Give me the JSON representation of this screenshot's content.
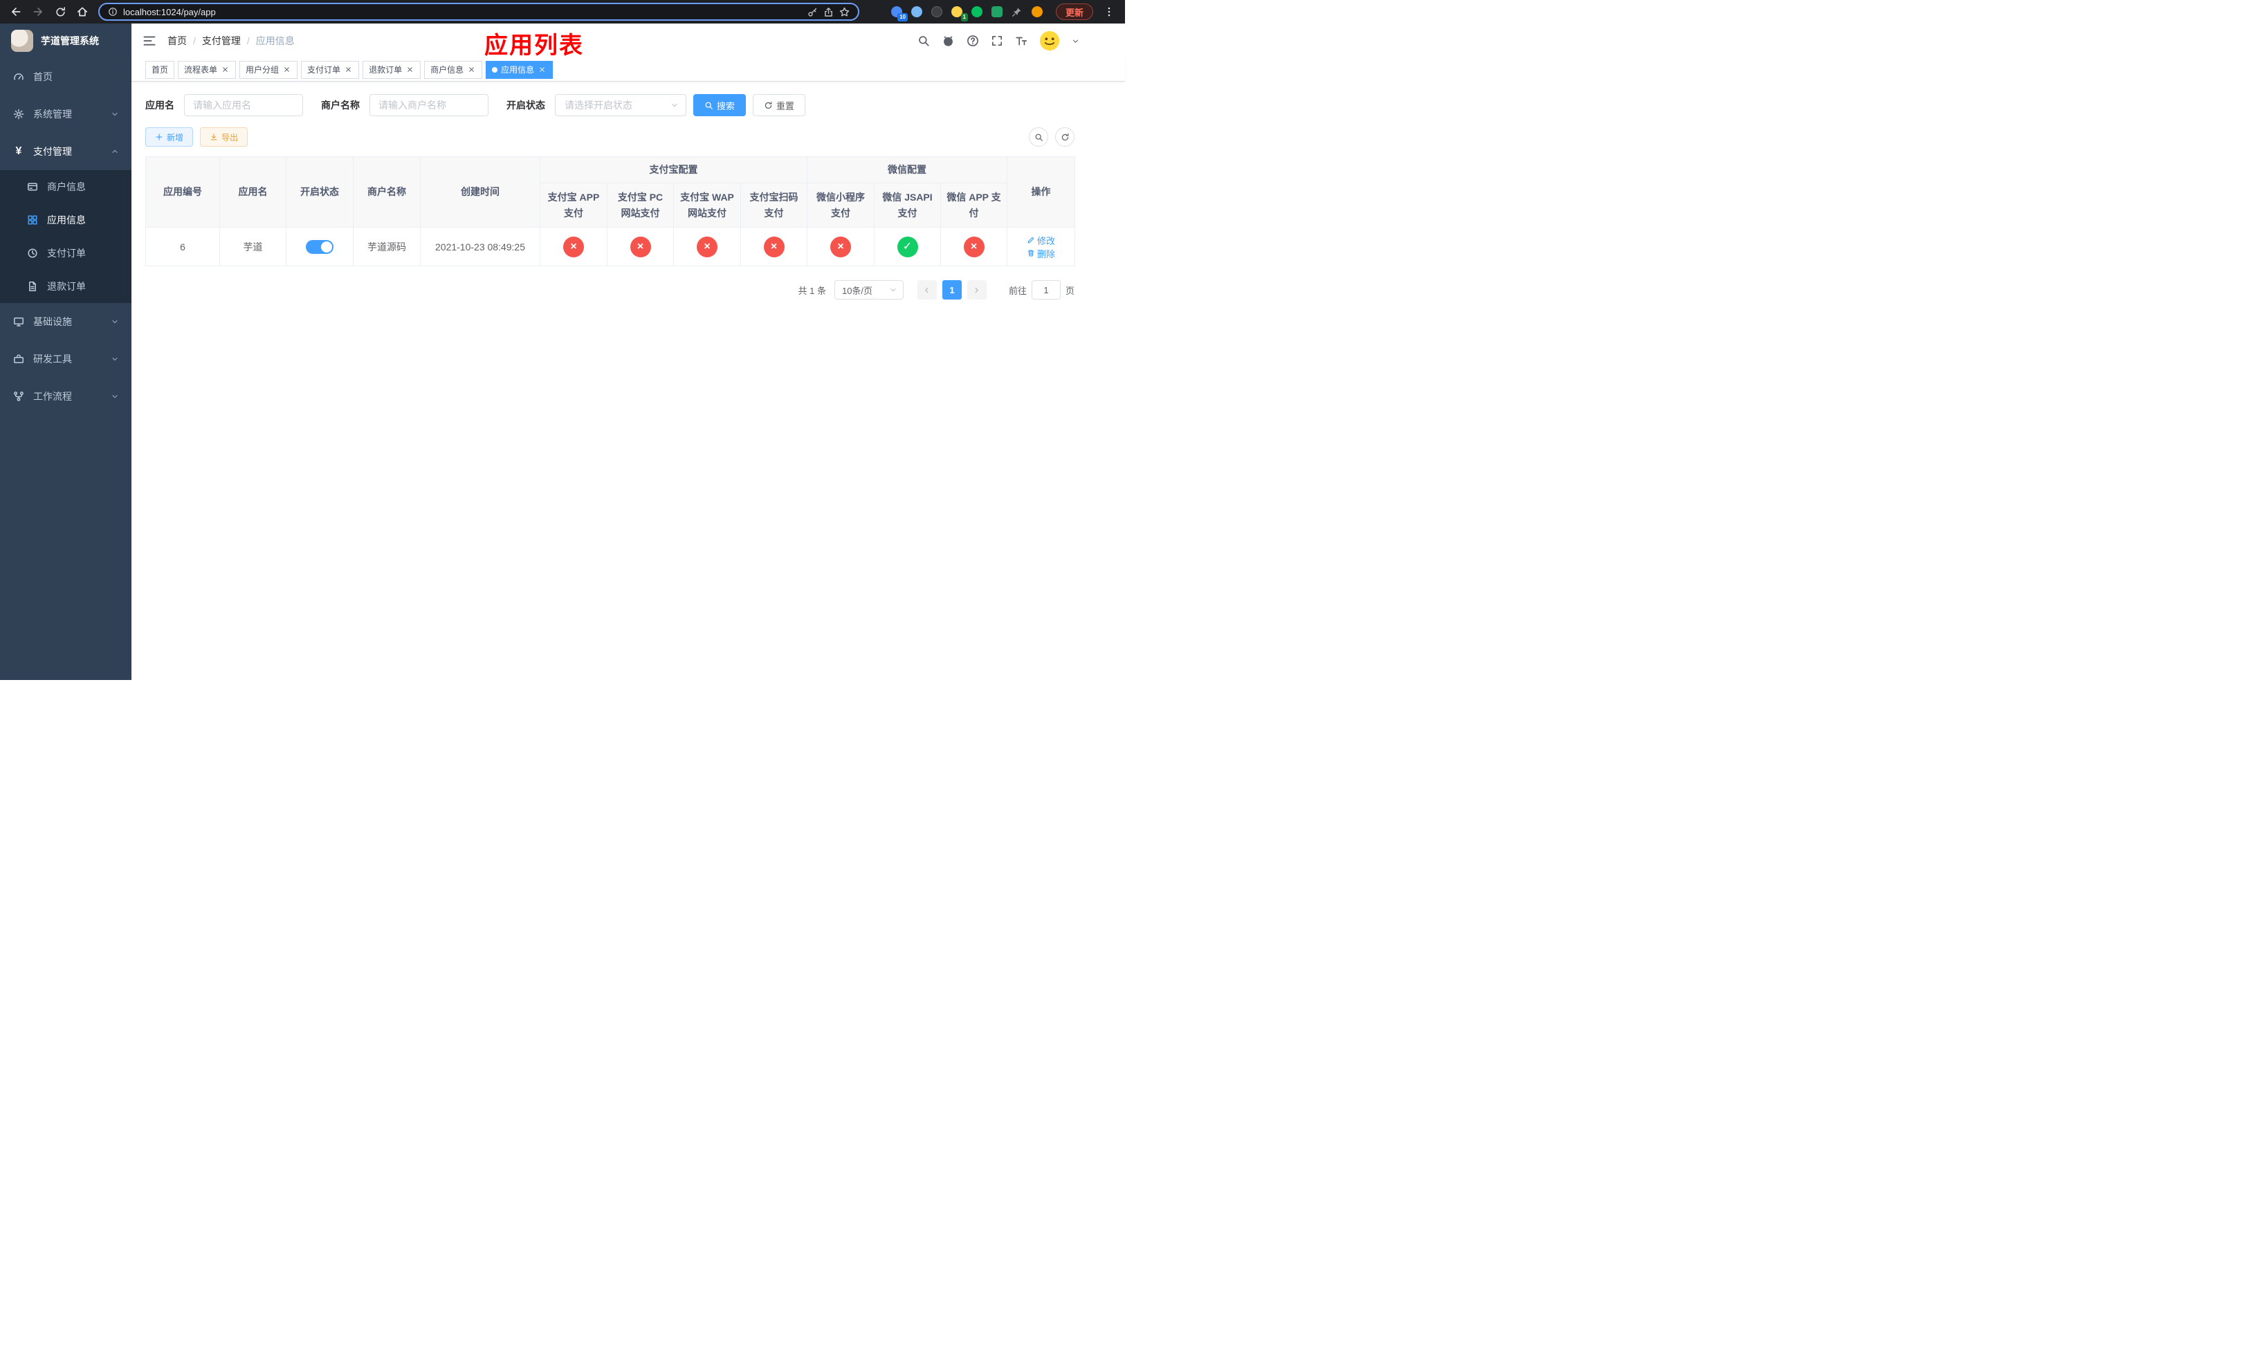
{
  "browser": {
    "url": "localhost:1024/pay/app",
    "update_label": "更新",
    "extensions": {
      "badge_blue": "10",
      "badge_green": "1"
    }
  },
  "sidebar": {
    "logo_title": "芋道管理系统",
    "menu": [
      {
        "label": "首页"
      },
      {
        "label": "系统管理"
      },
      {
        "label": "支付管理",
        "icon_glyph": "¥",
        "children": [
          {
            "label": "商户信息"
          },
          {
            "label": "应用信息"
          },
          {
            "label": "支付订单"
          },
          {
            "label": "退款订单"
          }
        ]
      },
      {
        "label": "基础设施"
      },
      {
        "label": "研发工具"
      },
      {
        "label": "工作流程"
      }
    ]
  },
  "navbar": {
    "breadcrumb": [
      "首页",
      "支付管理",
      "应用信息"
    ],
    "separator": "/",
    "page_title": "应用列表"
  },
  "tabs": [
    {
      "label": "首页",
      "closable": false,
      "active": false
    },
    {
      "label": "流程表单",
      "closable": true,
      "active": false
    },
    {
      "label": "用户分组",
      "closable": true,
      "active": false
    },
    {
      "label": "支付订单",
      "closable": true,
      "active": false
    },
    {
      "label": "退款订单",
      "closable": true,
      "active": false
    },
    {
      "label": "商户信息",
      "closable": true,
      "active": false
    },
    {
      "label": "应用信息",
      "closable": true,
      "active": true
    }
  ],
  "filters": {
    "app_name_label": "应用名",
    "app_name_placeholder": "请输入应用名",
    "merchant_label": "商户名称",
    "merchant_placeholder": "请输入商户名称",
    "status_label": "开启状态",
    "status_placeholder": "请选择开启状态",
    "search_label": "搜索",
    "reset_label": "重置"
  },
  "toolbar": {
    "add_label": "新增",
    "export_label": "导出"
  },
  "table": {
    "headers": {
      "app_id": "应用编号",
      "app_name": "应用名",
      "status": "开启状态",
      "merchant": "商户名称",
      "created": "创建时间",
      "alipay_group": "支付宝配置",
      "wechat_group": "微信配置",
      "alipay_app": "支付宝 APP 支付",
      "alipay_pc": "支付宝 PC 网站支付",
      "alipay_wap": "支付宝 WAP 网站支付",
      "alipay_qr": "支付宝扫码支付",
      "wx_mini": "微信小程序支付",
      "wx_jsapi": "微信 JSAPI 支付",
      "wx_app": "微信 APP 支付",
      "actions": "操作"
    },
    "rows": [
      {
        "app_id": "6",
        "app_name": "芋道",
        "status_enabled": true,
        "merchant": "芋道源码",
        "created": "2021-10-23 08:49:25",
        "alipay_app": false,
        "alipay_pc": false,
        "alipay_wap": false,
        "alipay_qr": false,
        "wx_mini": false,
        "wx_jsapi": true,
        "wx_app": false,
        "edit_label": "修改",
        "delete_label": "删除"
      }
    ]
  },
  "marks": {
    "fail": "×",
    "ok": "✓"
  },
  "pagination": {
    "total": "共 1 条",
    "page_size": "10条/页",
    "page": "1",
    "goto_label": "前往",
    "goto_value": "1",
    "unit_label": "页"
  },
  "colors": {
    "primary": "#409EFF",
    "success": "#13CE66",
    "danger": "#F5544C",
    "warning": "#E6A23C",
    "title_red": "#FF0000",
    "sidebar_bg": "#304156",
    "submenu_bg": "#1F2D3D"
  }
}
